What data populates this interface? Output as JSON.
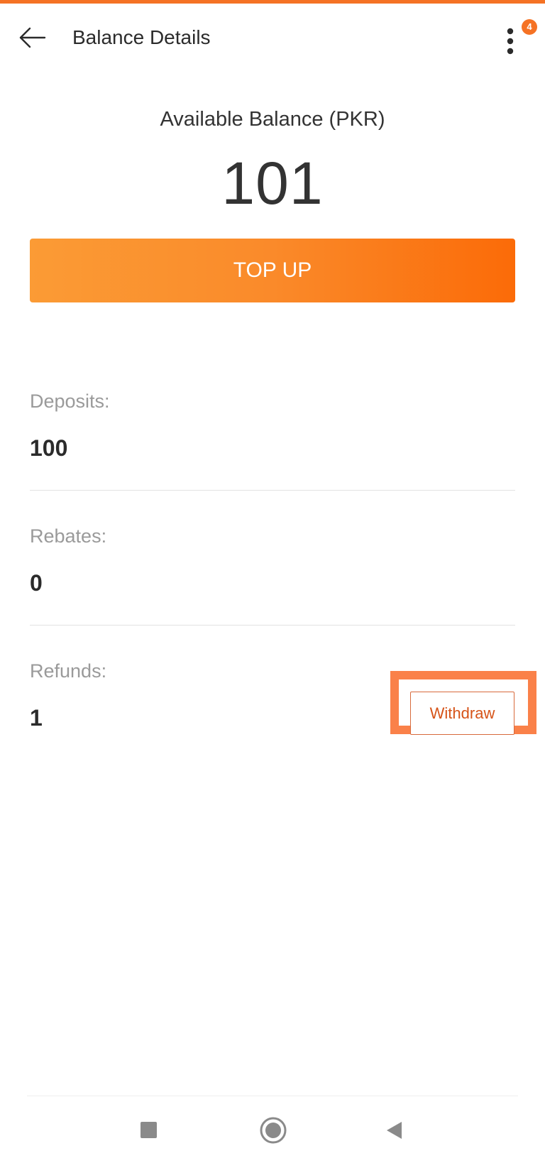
{
  "header": {
    "back_icon": "arrow-left-icon",
    "title": "Balance Details",
    "more_icon": "more-vertical-icon",
    "notification_count": "4"
  },
  "balance": {
    "label": "Available Balance (PKR)",
    "amount": "101",
    "topup_label": "TOP UP"
  },
  "details": [
    {
      "label": "Deposits:",
      "value": "100"
    },
    {
      "label": "Rebates:",
      "value": "0"
    },
    {
      "label": "Refunds:",
      "value": "1",
      "action_label": "Withdraw"
    }
  ],
  "nav": {
    "recents_icon": "square-icon",
    "home_icon": "circle-icon",
    "back_icon": "triangle-back-icon"
  },
  "colors": {
    "accent": "#f57224",
    "topup_gradient_start": "#fb9b35",
    "topup_gradient_end": "#fb6b08",
    "highlight": "#fa8149",
    "withdraw_text": "#d65318"
  }
}
